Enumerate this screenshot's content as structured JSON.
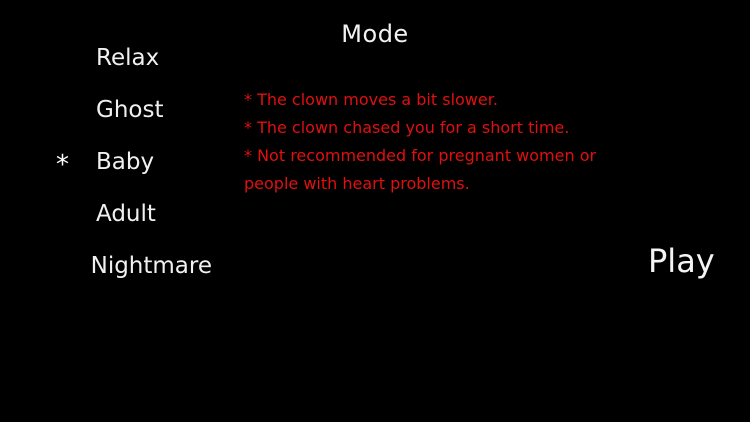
{
  "screen": {
    "title": "Mode",
    "colors": {
      "background": "#000000",
      "text": "#ffffff",
      "description": "#e01010"
    }
  },
  "modes": [
    {
      "label": "Relax",
      "selected": false
    },
    {
      "label": "Ghost",
      "selected": false
    },
    {
      "label": "Baby",
      "selected": true
    },
    {
      "label": "Adult",
      "selected": false
    },
    {
      "label": "Nightmare",
      "selected": false
    }
  ],
  "selection_marker": "*",
  "description": {
    "lines": [
      "* The clown moves a bit slower.",
      "* The clown chased you for a short time.",
      "* Not recommended for pregnant women or",
      "people with heart problems."
    ]
  },
  "play_label": "Play"
}
